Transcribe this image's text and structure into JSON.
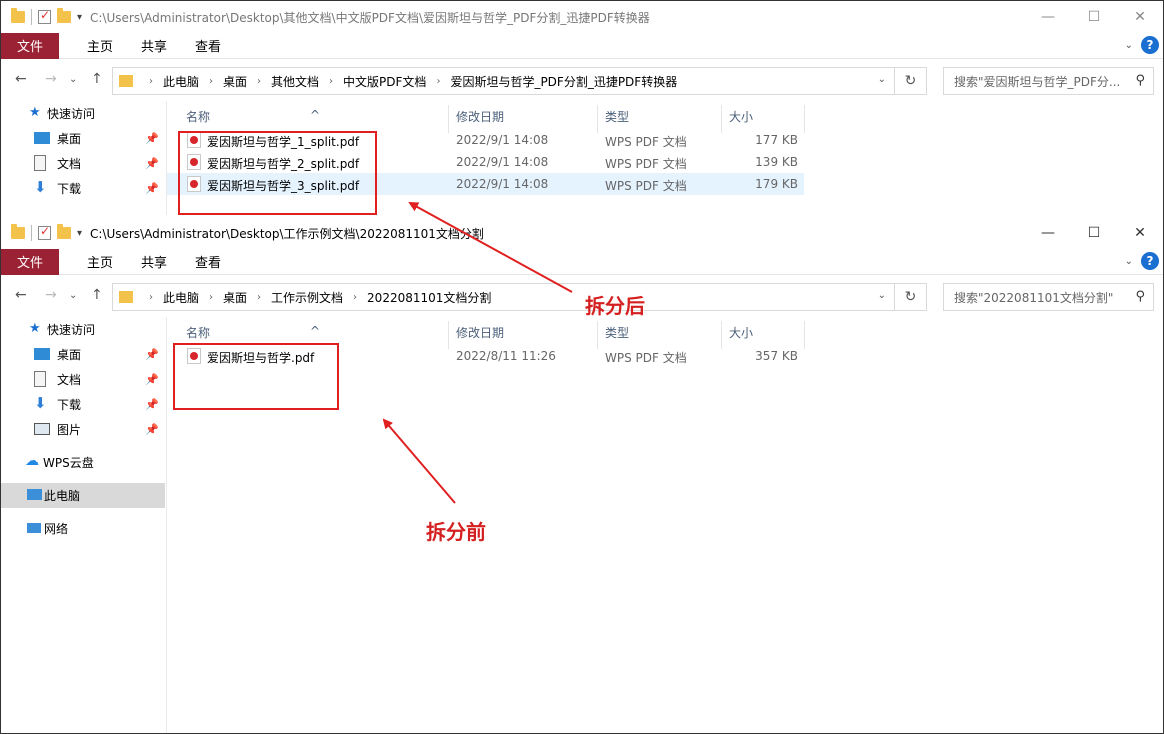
{
  "icons": {
    "help": "?"
  },
  "windows": [
    {
      "title": "C:\\Users\\Administrator\\Desktop\\其他文档\\中文版PDF文档\\爱因斯坦与哲学_PDF分割_迅捷PDF转换器",
      "ribbon": {
        "file": "文件",
        "tabs": [
          "主页",
          "共享",
          "查看"
        ]
      },
      "breadcrumb": [
        "此电脑",
        "桌面",
        "其他文档",
        "中文版PDF文档",
        "爱因斯坦与哲学_PDF分割_迅捷PDF转换器"
      ],
      "search_placeholder": "搜索\"爱因斯坦与哲学_PDF分...",
      "sidebar": [
        {
          "label": "快速访问"
        },
        {
          "label": "桌面"
        },
        {
          "label": "文档"
        },
        {
          "label": "下载"
        }
      ],
      "columns": {
        "name": "名称",
        "date": "修改日期",
        "type": "类型",
        "size": "大小"
      },
      "files": [
        {
          "name": "爱因斯坦与哲学_1_split.pdf",
          "date": "2022/9/1 14:08",
          "type": "WPS PDF 文档",
          "size": "177 KB"
        },
        {
          "name": "爱因斯坦与哲学_2_split.pdf",
          "date": "2022/9/1 14:08",
          "type": "WPS PDF 文档",
          "size": "139 KB"
        },
        {
          "name": "爱因斯坦与哲学_3_split.pdf",
          "date": "2022/9/1 14:08",
          "type": "WPS PDF 文档",
          "size": "179 KB"
        }
      ]
    },
    {
      "title": "C:\\Users\\Administrator\\Desktop\\工作示例文档\\2022081101文档分割",
      "ribbon": {
        "file": "文件",
        "tabs": [
          "主页",
          "共享",
          "查看"
        ]
      },
      "breadcrumb": [
        "此电脑",
        "桌面",
        "工作示例文档",
        "2022081101文档分割"
      ],
      "search_placeholder": "搜索\"2022081101文档分割\"",
      "sidebar": [
        {
          "label": "快速访问"
        },
        {
          "label": "桌面"
        },
        {
          "label": "文档"
        },
        {
          "label": "下载"
        },
        {
          "label": "图片"
        },
        {
          "label": "WPS云盘"
        },
        {
          "label": "此电脑"
        },
        {
          "label": "网络"
        }
      ],
      "columns": {
        "name": "名称",
        "date": "修改日期",
        "type": "类型",
        "size": "大小"
      },
      "files": [
        {
          "name": "爱因斯坦与哲学.pdf",
          "date": "2022/8/11 11:26",
          "type": "WPS PDF 文档",
          "size": "357 KB"
        }
      ]
    }
  ],
  "annotations": {
    "after": "拆分后",
    "before": "拆分前"
  },
  "colors": {
    "ribbon_file": "#9b2235",
    "annotation_red": "#e02020",
    "selected_row": "#e5f3ff",
    "help_blue": "#1a6fd1"
  }
}
